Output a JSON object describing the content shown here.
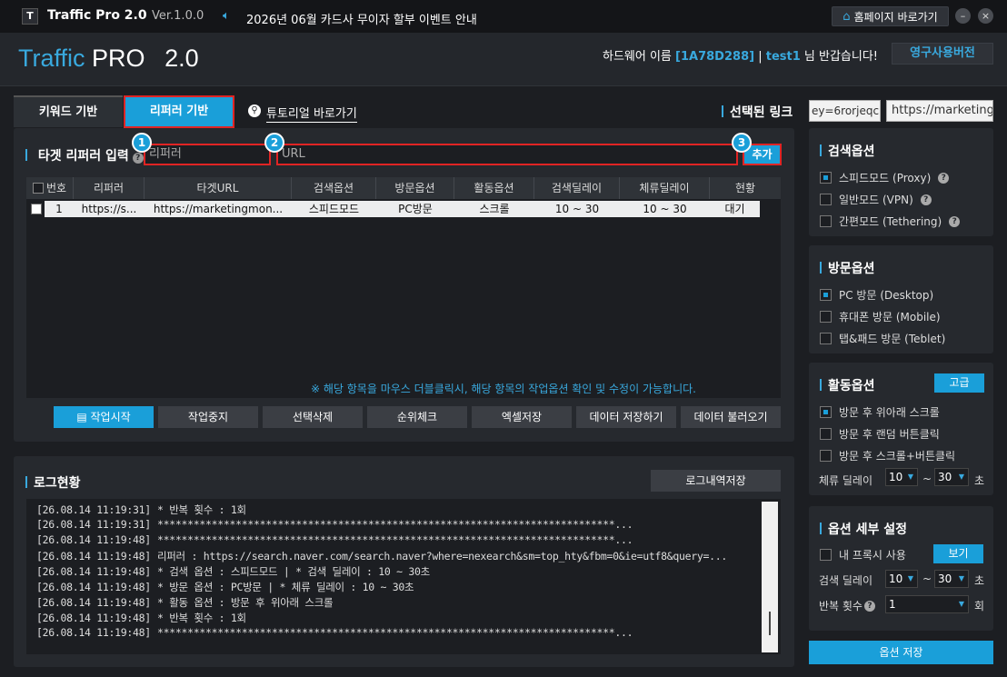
{
  "titlebar": {
    "logo_letter": "T",
    "app_name": "Traffic Pro 2.0",
    "version": "Ver.1.0.0",
    "notice": "2026년 06월 카드사 무이자 할부 이벤트 안내",
    "home_button": "홈페이지 바로가기",
    "minimize": "–",
    "close": "×"
  },
  "header": {
    "brand_part1": "Traffic",
    "brand_part2": "PRO",
    "brand_part3": "2.0",
    "hw_prefix": "하드웨어 이름",
    "hw_id": "[1A78D288]",
    "separator": "|",
    "user": "test1",
    "greeting": "님 반갑습니다!",
    "permanent_button": "영구사용버전"
  },
  "tabs": {
    "keyword": "키워드 기반",
    "referrer": "리퍼러 기반",
    "tutorial": "튜토리얼 바로가기",
    "selected_link": "선택된 링크",
    "link_value_1": "ey=6rorjeqc",
    "link_value_2": "https://marketing"
  },
  "target": {
    "title": "타겟 리퍼러 입력",
    "ref_placeholder": "리퍼러",
    "url_placeholder": "URL",
    "add_button": "추가",
    "badge1": "1",
    "badge2": "2",
    "badge3": "3"
  },
  "table": {
    "columns": [
      "번호",
      "리퍼러",
      "타겟URL",
      "검색옵션",
      "방문옵션",
      "활동옵션",
      "검색딜레이",
      "체류딜레이",
      "현황"
    ],
    "rows": [
      [
        "1",
        "https://s...",
        "https://marketingmon...",
        "스피드모드",
        "PC방문",
        "스크롤",
        "10 ~ 30",
        "10 ~ 30",
        "대기"
      ]
    ],
    "hint": "※ 해당 항목을 마우스 더블클릭시, 해당 항목의 작업옵션 확인 및 수정이 가능합니다."
  },
  "actions": {
    "start": "작업시작",
    "stop": "작업중지",
    "delete": "선택삭제",
    "rank": "순위체크",
    "excel": "엑셀저장",
    "save_data": "데이터 저장하기",
    "load_data": "데이터 불러오기"
  },
  "log": {
    "title": "로그현황",
    "save_button": "로그내역저장",
    "lines": [
      {
        "ts": "[26.08.14 11:19:31]",
        "msg": "* 반복 횟수 : 1회"
      },
      {
        "ts": "[26.08.14 11:19:31]",
        "msg": "****************************************************************************..."
      },
      {
        "ts": "[26.08.14 11:19:48]",
        "msg": "****************************************************************************..."
      },
      {
        "ts": "[26.08.14 11:19:48]",
        "msg": "리퍼러 : https://search.naver.com/search.naver?where=nexearch&sm=top_hty&fbm=0&ie=utf8&query=..."
      },
      {
        "ts": "[26.08.14 11:19:48]",
        "msg": "* 검색 옵션 : 스피드모드 | * 검색 딜레이 : 10 ~ 30초"
      },
      {
        "ts": "[26.08.14 11:19:48]",
        "msg": "* 방문 옵션 : PC방문 | * 체류 딜레이 : 10 ~ 30초"
      },
      {
        "ts": "[26.08.14 11:19:48]",
        "msg": "* 활동 옵션 : 방문 후 위아래 스크롤"
      },
      {
        "ts": "[26.08.14 11:19:48]",
        "msg": "* 반복 횟수 : 1회"
      },
      {
        "ts": "[26.08.14 11:19:48]",
        "msg": "****************************************************************************..."
      }
    ]
  },
  "search_options": {
    "title": "검색옵션",
    "items": [
      {
        "label": "스피드모드 (Proxy)",
        "checked": true
      },
      {
        "label": "일반모드 (VPN)",
        "checked": false
      },
      {
        "label": "간편모드 (Tethering)",
        "checked": false
      }
    ]
  },
  "visit_options": {
    "title": "방문옵션",
    "items": [
      {
        "label": "PC 방문 (Desktop)",
        "checked": true
      },
      {
        "label": "휴대폰 방문 (Mobile)",
        "checked": false
      },
      {
        "label": "탭&패드 방문 (Teblet)",
        "checked": false
      }
    ]
  },
  "activity_options": {
    "title": "활동옵션",
    "advanced_button": "고급",
    "items": [
      {
        "label": "방문 후 위아래 스크롤",
        "checked": true
      },
      {
        "label": "방문 후 랜덤 버튼클릭",
        "checked": false
      },
      {
        "label": "방문 후 스크롤+버튼클릭",
        "checked": false
      }
    ],
    "stay_delay_label": "체류 딜레이",
    "stay_from": "10",
    "stay_tilde": "~",
    "stay_to": "30",
    "stay_unit": "초"
  },
  "detail_options": {
    "title": "옵션 세부 설정",
    "proxy_label": "내 프록시 사용",
    "proxy_checked": false,
    "view_button": "보기",
    "search_delay_label": "검색 딜레이",
    "search_from": "10",
    "search_tilde": "~",
    "search_to": "30",
    "search_unit": "초",
    "repeat_label": "반복 횟수",
    "repeat_value": "1",
    "repeat_unit": "회",
    "save_button": "옵션 저장"
  },
  "colors": {
    "accent": "#1a9fd9",
    "highlight_border": "#e02424",
    "background": "#1c1e22",
    "panel": "#26292e"
  }
}
